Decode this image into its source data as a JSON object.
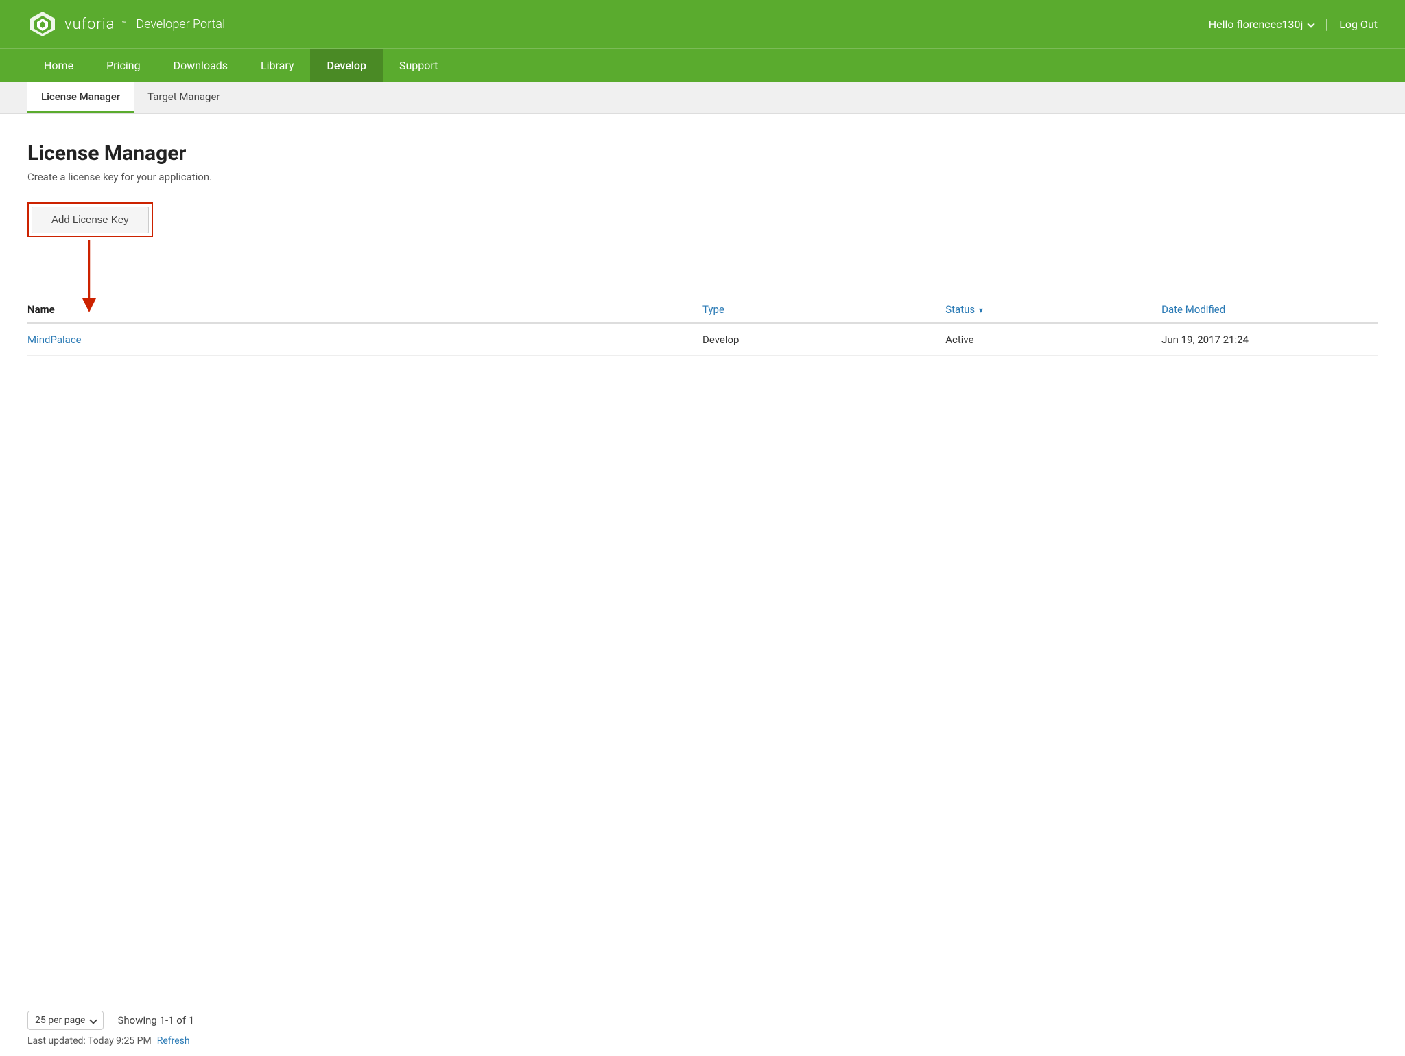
{
  "brand": {
    "name": "vuforia",
    "trademark": "™",
    "subtitle": "Developer Portal",
    "logo_alt": "Vuforia logo"
  },
  "user": {
    "greeting": "Hello florencec130j",
    "logout": "Log Out"
  },
  "nav": {
    "items": [
      {
        "label": "Home",
        "active": false
      },
      {
        "label": "Pricing",
        "active": false
      },
      {
        "label": "Downloads",
        "active": false
      },
      {
        "label": "Library",
        "active": false
      },
      {
        "label": "Develop",
        "active": true
      },
      {
        "label": "Support",
        "active": false
      }
    ]
  },
  "sub_nav": {
    "items": [
      {
        "label": "License Manager",
        "active": true
      },
      {
        "label": "Target Manager",
        "active": false
      }
    ]
  },
  "page": {
    "title": "License Manager",
    "subtitle": "Create a license key for your application.",
    "add_button": "Add License Key"
  },
  "table": {
    "columns": [
      {
        "label": "Name",
        "sortable": false
      },
      {
        "label": "Type",
        "sortable": true
      },
      {
        "label": "Status",
        "sortable": true,
        "sort_arrow": "▾"
      },
      {
        "label": "Date Modified",
        "sortable": true
      }
    ],
    "rows": [
      {
        "name": "MindPalace",
        "type": "Develop",
        "status": "Active",
        "date_modified": "Jun 19, 2017 21:24"
      }
    ]
  },
  "footer": {
    "per_page_label": "25 per page",
    "showing": "Showing 1-1 of 1",
    "last_updated": "Last updated: Today 9:25 PM",
    "refresh": "Refresh"
  },
  "colors": {
    "green": "#5aab2e",
    "blue_link": "#2a7ab5",
    "red_annotation": "#cc2200"
  }
}
